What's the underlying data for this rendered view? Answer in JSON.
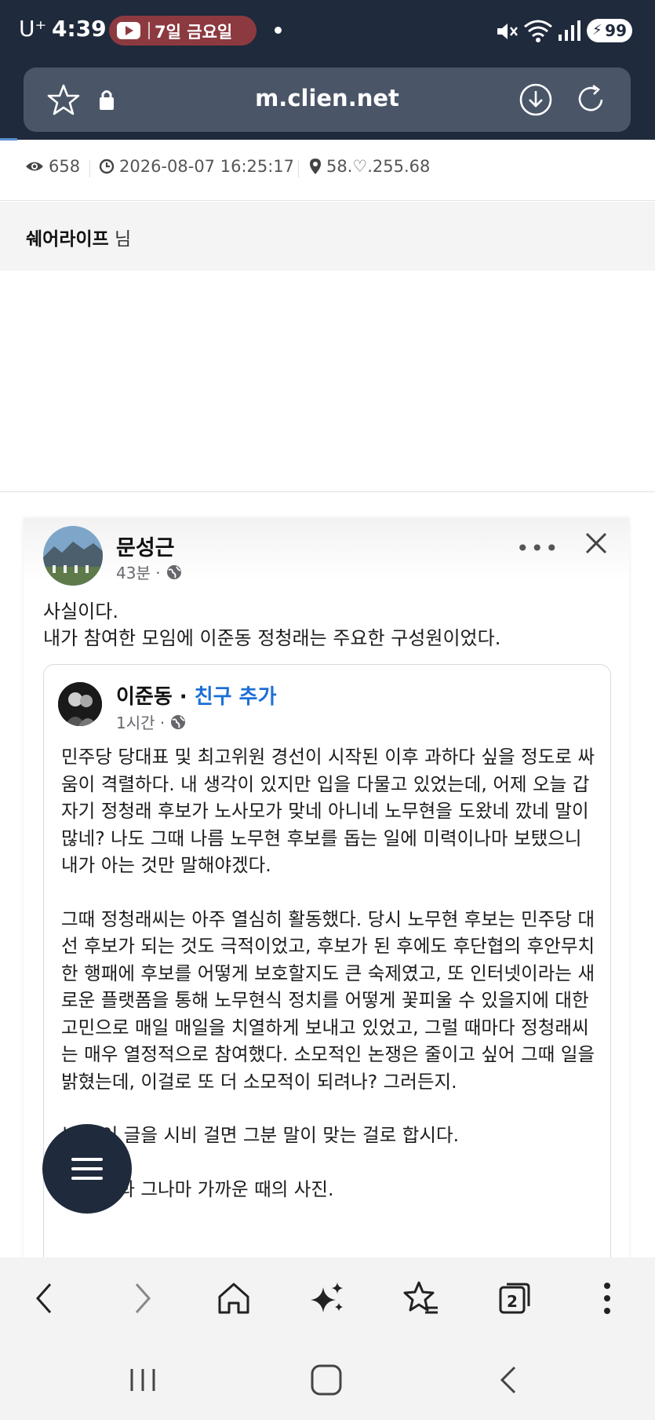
{
  "status_bar": {
    "carrier": "U⁺",
    "time": "4:39",
    "notification": "7일 금요일",
    "battery": "99"
  },
  "browser": {
    "url": "m.clien.net",
    "icons": [
      "star-icon",
      "lock-icon",
      "download-icon",
      "reload-icon"
    ]
  },
  "post_meta": {
    "views": "658",
    "datetime": "2026-08-07 16:25:17",
    "ip": "58.♡.255.68"
  },
  "author": {
    "name": "쉐어라이프",
    "suffix": "님"
  },
  "fb_post": {
    "name": "문성근",
    "time": "43분 ·",
    "text_line1": "사실이다.",
    "text_line2": "내가 참여한 모임에 이준동 정청래는 주요한 구성원이었다.",
    "shared": {
      "name": "이준동 ·",
      "friend_link": "친구 추가",
      "time": "1시간 ·",
      "para1": "민주당 당대표 및 최고위원 경선이 시작된 이후 과하다 싶을 정도로 싸움이 격렬하다. 내 생각이 있지만 입을 다물고 있었는데, 어제 오늘 갑자기 정청래 후보가 노사모가 맞네 아니네 노무현을 도왔네 깠네 말이 많네? 나도 그때 나름 노무현 후보를 돕는 일에 미력이나마 보탰으니 내가 아는 것만 말해야겠다.",
      "para2": "그때 정청래씨는 아주 열심히 활동했다. 당시 노무현 후보는 민주당 대선 후보가 되는 것도 극적이었고, 후보가 된 후에도 후단협의 후안무치한 행패에 후보를 어떻게 보호할지도 큰 숙제였고, 또 인터넷이라는 새로운 플랫폼을 통해 노무현식 정치를 어떻게 꽃피울 수 있을지에 대한 고민으로 매일 매일을 치열하게 보내고 있었고, 그럴 때마다 정청래씨는 매우 열정적으로 참여했다. 소모적인 논쟁은 줄이고 싶어 그때 일을 밝혔는데, 이걸로 또 더 소모적이 되려나? 그러든지.",
      "para3": "누가 이 글을 시비 걸면 그분 말이 맞는 걸로 합시다.",
      "para4": "그 시절과 그나마 가까운 때의 사진."
    }
  },
  "toolbar": {
    "tab_count": "2",
    "items": [
      "back-icon",
      "forward-icon",
      "home-icon",
      "sparkle-icon",
      "bookmarks-icon",
      "tabs-icon",
      "more-icon"
    ]
  },
  "colors": {
    "header_bg": "#1f2a3c",
    "url_bg": "#4a5668",
    "link_blue": "#1d6fd6",
    "notification_pill": "#8c3a40"
  }
}
